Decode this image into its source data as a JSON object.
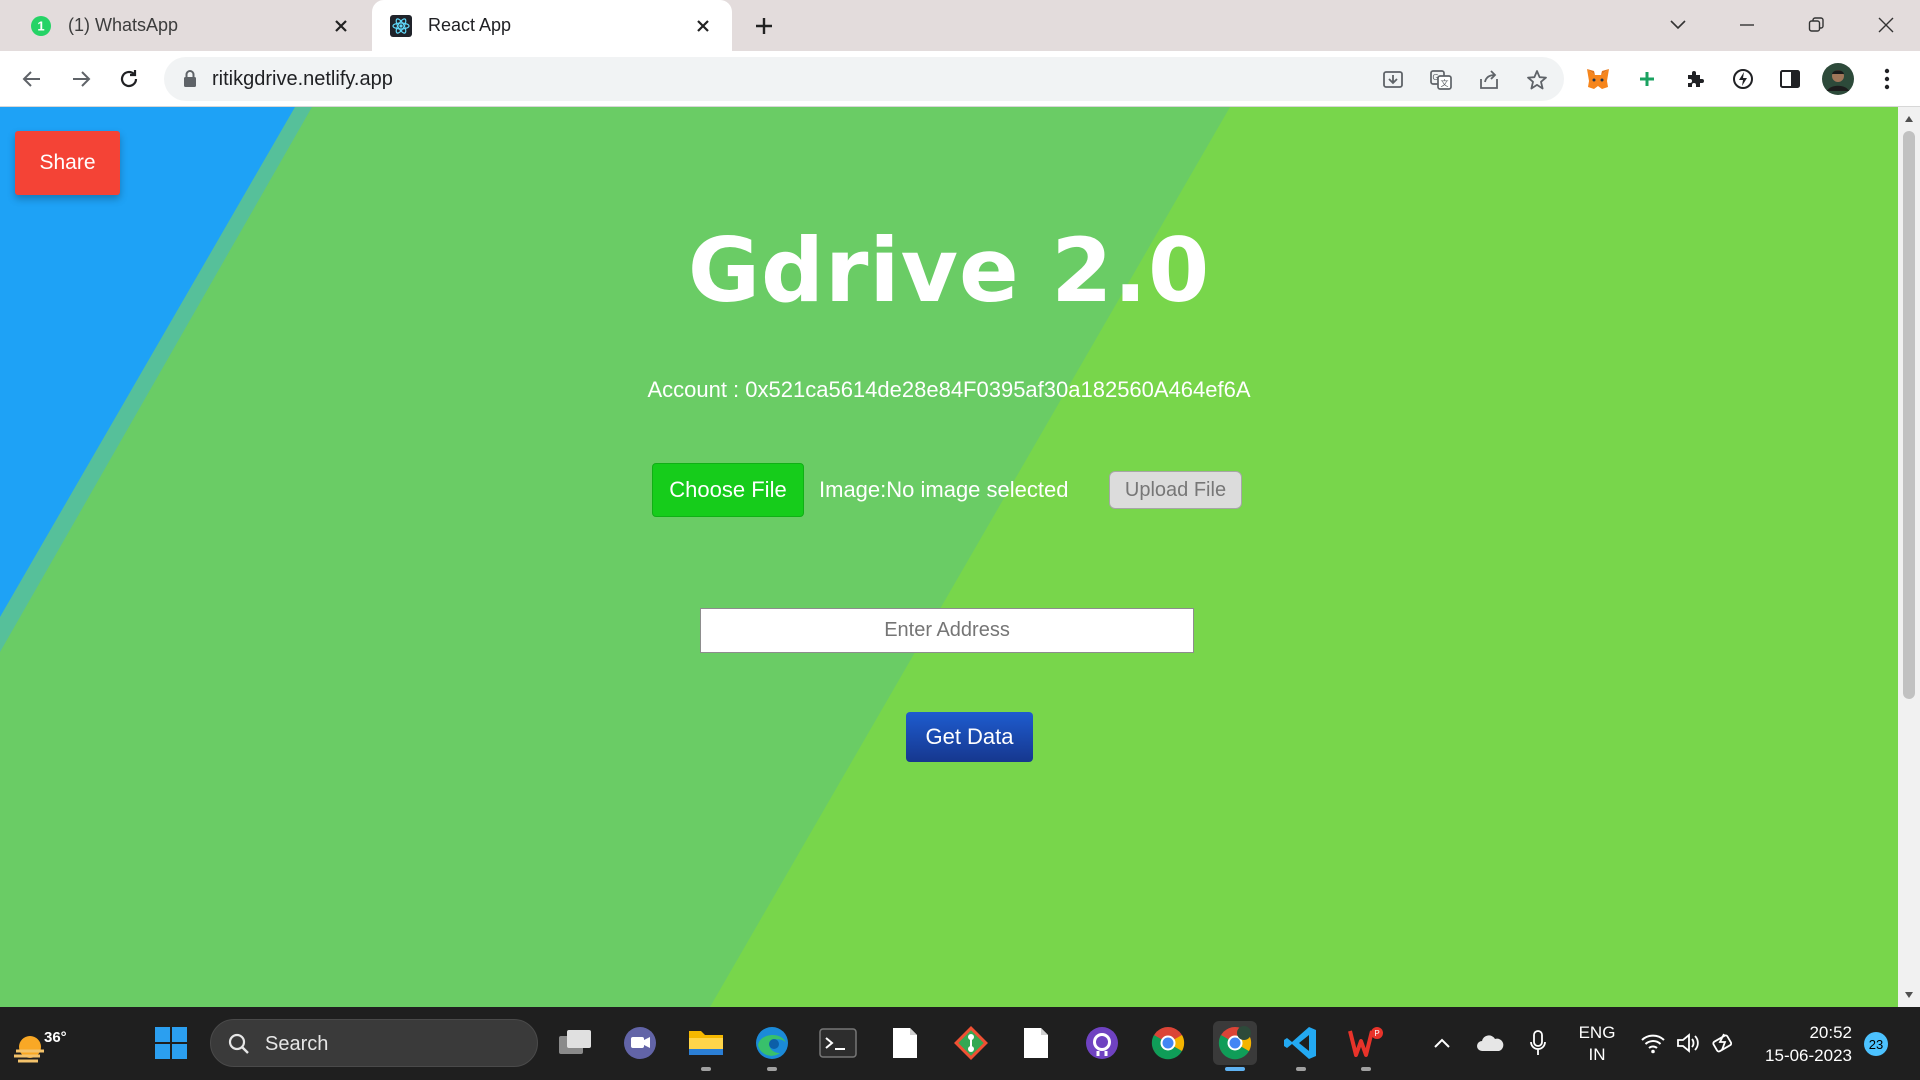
{
  "browser": {
    "tabs": [
      {
        "title": "(1) WhatsApp",
        "icon": "whatsapp-icon",
        "badge": "1",
        "active": false
      },
      {
        "title": "React App",
        "icon": "react-icon",
        "active": true
      }
    ],
    "url": "ritikgdrive.netlify.app"
  },
  "page": {
    "share_label": "Share",
    "title": "Gdrive 2.0",
    "account": "Account : 0x521ca5614de28e84F0395af30a182560A464ef6A",
    "choose_file_label": "Choose File",
    "image_status": "Image:No image selected",
    "upload_label": "Upload File",
    "address_placeholder": "Enter Address",
    "get_data_label": "Get Data",
    "colors": {
      "green_light": "#78d64b",
      "green": "#6acc65",
      "blue": "#1ea2f6",
      "share_red": "#f44336",
      "choose_green": "#16cc1b",
      "get_data_blue": "#1e4fb5"
    }
  },
  "taskbar": {
    "weather_temp": "36°",
    "search_label": "Search",
    "language_line1": "ENG",
    "language_line2": "IN",
    "time": "20:52",
    "date": "15-06-2023",
    "notification_count": "23"
  }
}
